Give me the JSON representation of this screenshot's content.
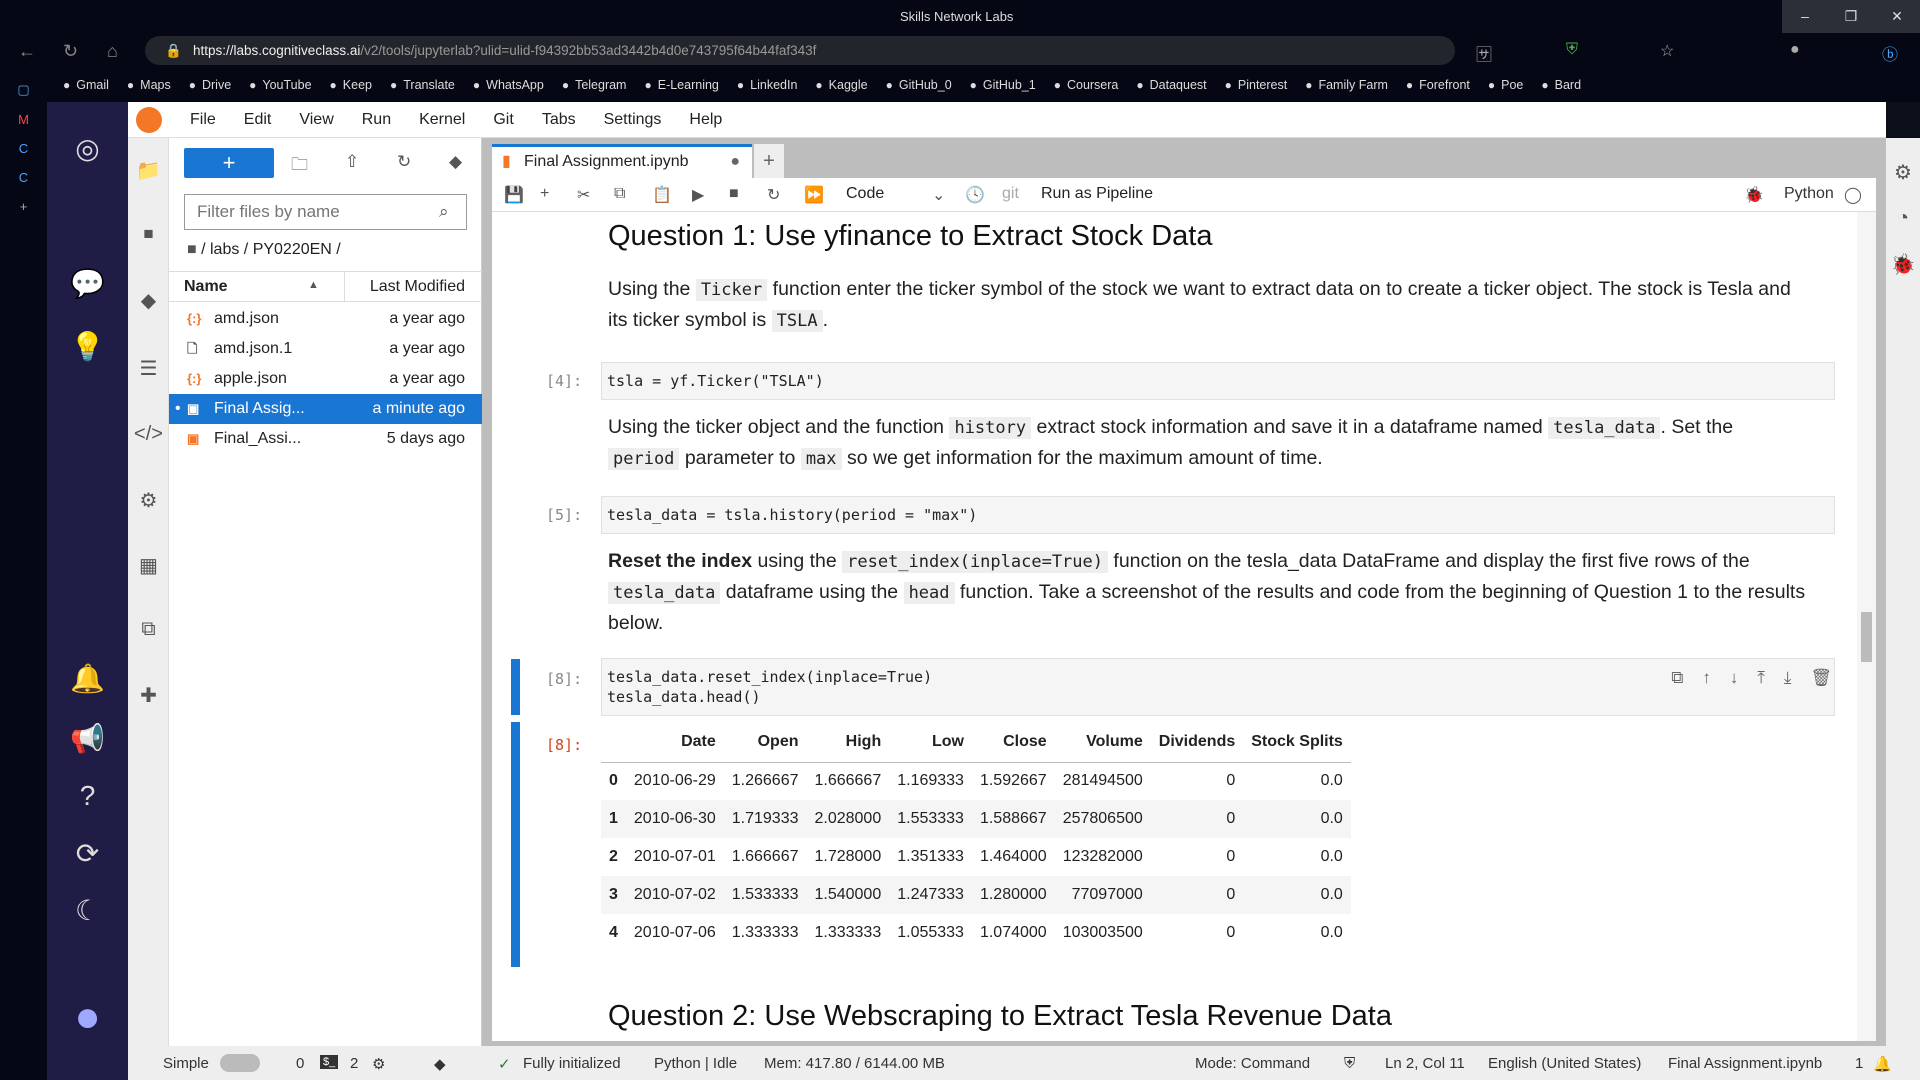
{
  "browser": {
    "window_title": "Skills Network Labs",
    "url_host": "https://labs.cognitiveclass.ai",
    "url_path": "/v2/tools/jupyterlab?ulid=ulid-f94392bb53ad3442b4d0e743795f64b44faf343f",
    "bookmarks": [
      "Gmail",
      "Maps",
      "Drive",
      "YouTube",
      "Keep",
      "Translate",
      "WhatsApp",
      "Telegram",
      "E-Learning",
      "LinkedIn",
      "Kaggle",
      "GitHub_0",
      "GitHub_1",
      "Coursera",
      "Dataquest",
      "Pinterest",
      "Family Farm",
      "Forefront",
      "Poe",
      "Bard"
    ]
  },
  "menu": [
    "File",
    "Edit",
    "View",
    "Run",
    "Kernel",
    "Git",
    "Tabs",
    "Settings",
    "Help"
  ],
  "filebrowser": {
    "filter_placeholder": "Filter files by name",
    "breadcrumb": "/ labs / PY0220EN /",
    "col_name": "Name",
    "col_modified": "Last Modified",
    "files": [
      {
        "name": "amd.json",
        "modified": "a year ago",
        "icon": "json-icon"
      },
      {
        "name": "amd.json.1",
        "modified": "a year ago",
        "icon": "file-icon"
      },
      {
        "name": "apple.json",
        "modified": "a year ago",
        "icon": "json-icon"
      },
      {
        "name": "Final Assig...",
        "modified": "a minute ago",
        "icon": "notebook-icon",
        "selected": true
      },
      {
        "name": "Final_Assi...",
        "modified": "5 days ago",
        "icon": "notebook-icon"
      }
    ]
  },
  "tab": {
    "title": "Final Assignment.ipynb"
  },
  "toolbar": {
    "cell_type": "Code",
    "git": "git",
    "pipeline": "Run as Pipeline",
    "kernel": "Python"
  },
  "notebook": {
    "q1_title": "Question 1: Use yfinance to Extract Stock Data",
    "md1": {
      "a": "Using the ",
      "code1": "Ticker",
      "b": " function enter the ticker symbol of the stock we want to extract data on to create a ticker object. The stock is Tesla and its ticker symbol is ",
      "code2": "TSLA",
      "c": "."
    },
    "cell4": {
      "prompt": "[4]:",
      "code": "tsla = yf.Ticker(\"TSLA\")"
    },
    "md2": {
      "a": "Using the ticker object and the function ",
      "code1": "history",
      "b": " extract stock information and save it in a dataframe named ",
      "code2": "tesla_data",
      "c": ". Set the ",
      "code3": "period",
      "d": " parameter to ",
      "code4": "max",
      "e": " so we get information for the maximum amount of time."
    },
    "cell5": {
      "prompt": "[5]:",
      "code": "tesla_data = tsla.history(period = \"max\")"
    },
    "md3": {
      "bold": "Reset the index",
      "a": " using the ",
      "code1": "reset_index(inplace=True)",
      "b": " function on the tesla_data DataFrame and display the first five rows of the ",
      "code2": "tesla_data",
      "c": " dataframe using the ",
      "code3": "head",
      "d": " function. Take a screenshot of the results and code from the beginning of Question 1 to the results below."
    },
    "cell8": {
      "prompt": "[8]:",
      "line1": "tesla_data.reset_index(inplace=True)",
      "line2": "tesla_data.head()"
    },
    "out8": {
      "prompt": "[8]:",
      "columns": [
        "",
        "Date",
        "Open",
        "High",
        "Low",
        "Close",
        "Volume",
        "Dividends",
        "Stock Splits"
      ],
      "rows": [
        [
          "0",
          "2010-06-29",
          "1.266667",
          "1.666667",
          "1.169333",
          "1.592667",
          "281494500",
          "0",
          "0.0"
        ],
        [
          "1",
          "2010-06-30",
          "1.719333",
          "2.028000",
          "1.553333",
          "1.588667",
          "257806500",
          "0",
          "0.0"
        ],
        [
          "2",
          "2010-07-01",
          "1.666667",
          "1.728000",
          "1.351333",
          "1.464000",
          "123282000",
          "0",
          "0.0"
        ],
        [
          "3",
          "2010-07-02",
          "1.533333",
          "1.540000",
          "1.247333",
          "1.280000",
          "77097000",
          "0",
          "0.0"
        ],
        [
          "4",
          "2010-07-06",
          "1.333333",
          "1.333333",
          "1.055333",
          "1.074000",
          "103003500",
          "0",
          "0.0"
        ]
      ]
    },
    "q2_title": "Question 2: Use Webscraping to Extract Tesla Revenue Data"
  },
  "status": {
    "mode_label": "Simple",
    "terminals": "0",
    "kernels": "2",
    "init": "Fully initialized",
    "kernel_status": "Python | Idle",
    "mem": "Mem: 417.80 / 6144.00 MB",
    "mode": "Mode: Command",
    "cursor": "Ln 2, Col 11",
    "lang": "English (United States)",
    "file": "Final Assignment.ipynb",
    "notifications": "1"
  }
}
